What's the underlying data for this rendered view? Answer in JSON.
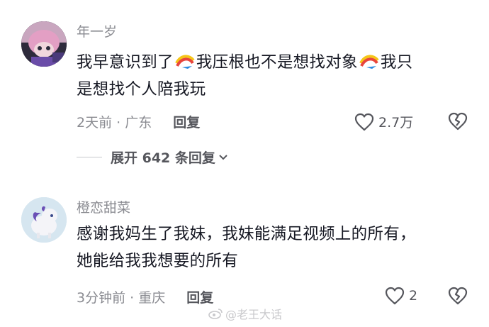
{
  "comments": [
    {
      "username": "年一岁",
      "line1_parts": [
        "我早意识到了",
        "我压根也不是想找对象",
        "我只"
      ],
      "line2": "是想找个人陪我玩",
      "meta": "2天前 · 广东",
      "reply_label": "回复",
      "likes": "2.7万",
      "expand_label": "展开 642 条回复"
    },
    {
      "username": "橙恋甜菜",
      "line1": "感谢我妈生了我妹，我妹能满足视频上的所有，",
      "line2": "她能给我我想要的所有",
      "meta": "3分钟前 · 重庆",
      "reply_label": "回复",
      "likes": "2"
    }
  ],
  "watermark": "@老王大话",
  "icons": {
    "like": "heart-outline-icon",
    "dislike": "broken-heart-icon",
    "expand": "chevron-down-icon",
    "emoji": "rainbow-swoosh-emoji-icon"
  },
  "colors": {
    "text": "#161823",
    "secondary": "#8a8b91",
    "action": "#55565c"
  }
}
